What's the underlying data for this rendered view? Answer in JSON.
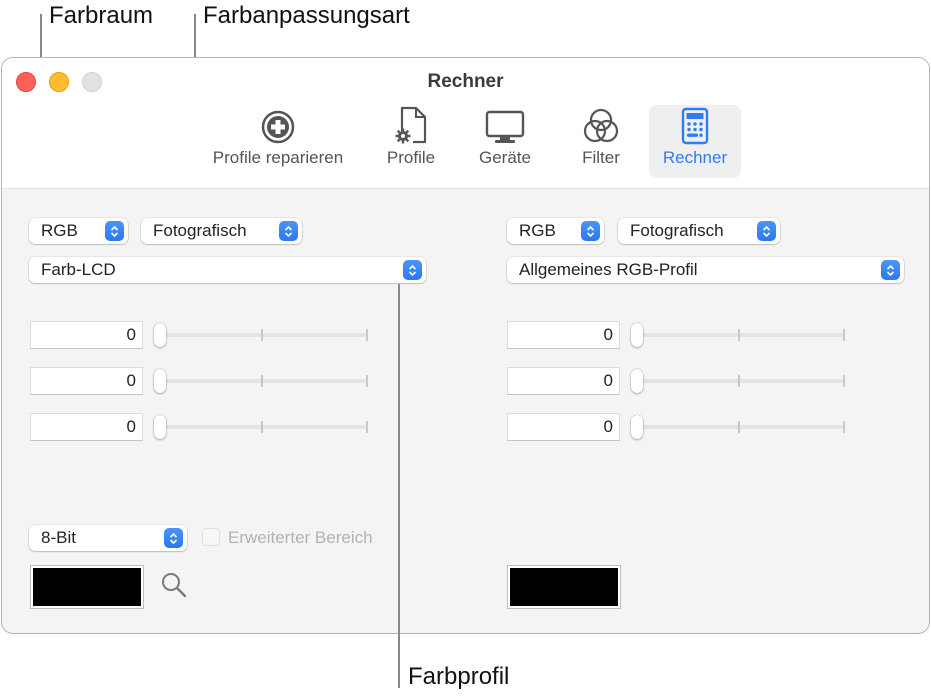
{
  "callouts": {
    "color_space": "Farbraum",
    "rendering_intent": "Farbanpassungsart",
    "color_profile": "Farbprofil"
  },
  "window": {
    "title": "Rechner"
  },
  "toolbar": {
    "items": [
      {
        "label": "Profile reparieren",
        "icon": "repair-plus-circle-icon",
        "active": false
      },
      {
        "label": "Profile",
        "icon": "profile-document-gear-icon",
        "active": false
      },
      {
        "label": "Geräte",
        "icon": "display-monitor-icon",
        "active": false
      },
      {
        "label": "Filter",
        "icon": "filter-circles-icon",
        "active": false
      },
      {
        "label": "Rechner",
        "icon": "calculator-icon",
        "active": true
      }
    ],
    "accent_color": "#2f7cf6"
  },
  "left_panel": {
    "color_space": "RGB",
    "rendering_intent": "Fotografisch",
    "profile": "Farb-LCD",
    "channels": [
      {
        "value": "0",
        "slider_fraction": 0
      },
      {
        "value": "0",
        "slider_fraction": 0
      },
      {
        "value": "0",
        "slider_fraction": 0
      }
    ],
    "bit_depth": "8-Bit",
    "extended_range_label": "Erweiterter Bereich",
    "extended_range_checked": false,
    "swatch_color": "#000000",
    "magnifier_icon": "magnifier-icon"
  },
  "right_panel": {
    "color_space": "RGB",
    "rendering_intent": "Fotografisch",
    "profile": "Allgemeines RGB-Profil",
    "channels": [
      {
        "value": "0",
        "slider_fraction": 0
      },
      {
        "value": "0",
        "slider_fraction": 0
      },
      {
        "value": "0",
        "slider_fraction": 0
      }
    ],
    "swatch_color": "#000000"
  }
}
